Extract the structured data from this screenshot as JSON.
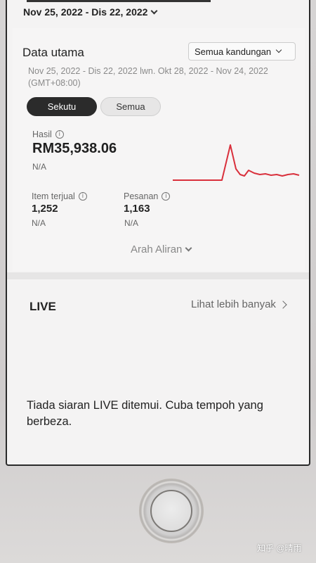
{
  "header": {
    "date_range": "Nov 25, 2022 - Dis 22, 2022"
  },
  "overview": {
    "title": "Data utama",
    "filter_label": "Semua kandungan",
    "period_text": "Nov 25, 2022 - Dis 22, 2022 lwn. Okt 28, 2022 - Nov 24, 2022 (GMT+08:00)",
    "segments": [
      "Sekutu",
      "Semua"
    ],
    "selected_segment": "Sekutu",
    "revenue": {
      "label": "Hasil",
      "value": "RM35,938.06",
      "change": "N/A"
    },
    "items_sold": {
      "label": "Item terjual",
      "value": "1,252",
      "change": "N/A"
    },
    "orders": {
      "label": "Pesanan",
      "value": "1,163",
      "change": "N/A"
    },
    "trend_link": "Arah Aliran",
    "sparkline_color": "#d9303c"
  },
  "live": {
    "title": "LIVE",
    "see_more": "Lihat lebih banyak",
    "empty_message": "Tiada siaran LIVE ditemui. Cuba tempoh yang berbeza."
  },
  "watermark": "知乎 @晴雨"
}
